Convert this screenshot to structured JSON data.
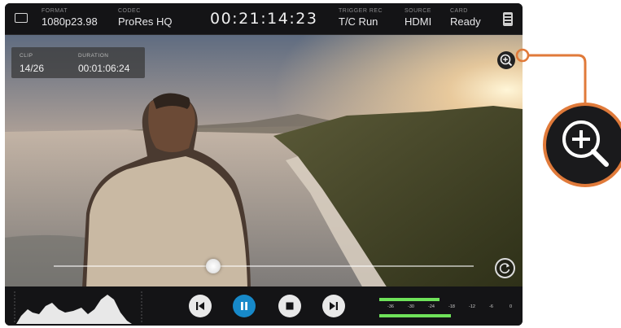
{
  "topbar": {
    "format": {
      "label": "FORMAT",
      "value": "1080p23.98"
    },
    "codec": {
      "label": "CODEC",
      "value": "ProRes HQ"
    },
    "timecode": "00:21:14:23",
    "trigger": {
      "label": "TRIGGER REC",
      "value": "T/C Run"
    },
    "source": {
      "label": "SOURCE",
      "value": "HDMI"
    },
    "card": {
      "label": "CARD",
      "value": "Ready"
    }
  },
  "clip_info": {
    "clip": {
      "label": "CLIP",
      "value": "14/26"
    },
    "duration": {
      "label": "DURATION",
      "value": "00:01:06:24"
    }
  },
  "playback": {
    "position": 0.38
  },
  "audio_meters": {
    "scale": [
      "-36",
      "-30",
      "-24",
      "-18",
      "-12",
      "-6",
      "0"
    ],
    "levels": [
      0.46,
      0.55
    ]
  },
  "colors": {
    "accent_blue": "#1789c9",
    "callout_orange": "#e07a3a",
    "meter_green": "#6fe35a"
  },
  "icons": [
    "screen-icon",
    "menu-icon",
    "zoom-in-icon",
    "loop-icon",
    "previous-icon",
    "pause-icon",
    "stop-icon",
    "next-icon"
  ]
}
